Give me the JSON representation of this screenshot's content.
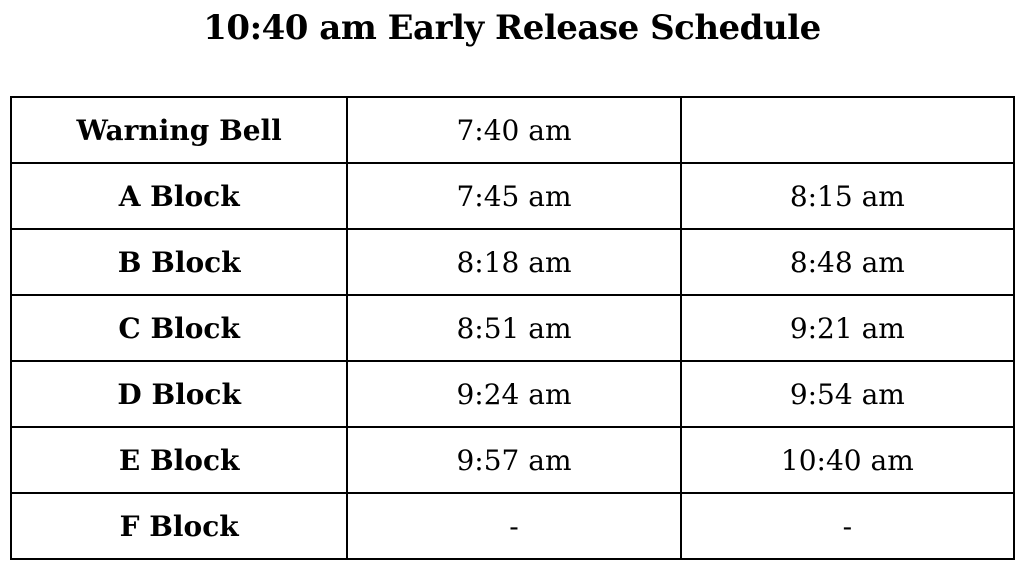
{
  "document": {
    "title": "10:40 am Early Release Schedule"
  },
  "schedule": {
    "rows": [
      {
        "label": "Warning Bell",
        "start": "7:40 am",
        "end": ""
      },
      {
        "label": "A Block",
        "start": "7:45 am",
        "end": "8:15 am"
      },
      {
        "label": "B Block",
        "start": "8:18 am",
        "end": "8:48 am"
      },
      {
        "label": "C Block",
        "start": "8:51 am",
        "end": "9:21 am"
      },
      {
        "label": "D Block",
        "start": "9:24 am",
        "end": "9:54 am"
      },
      {
        "label": "E Block",
        "start": "9:57 am",
        "end": "10:40 am"
      },
      {
        "label": "F Block",
        "start": "-",
        "end": "-"
      }
    ]
  }
}
